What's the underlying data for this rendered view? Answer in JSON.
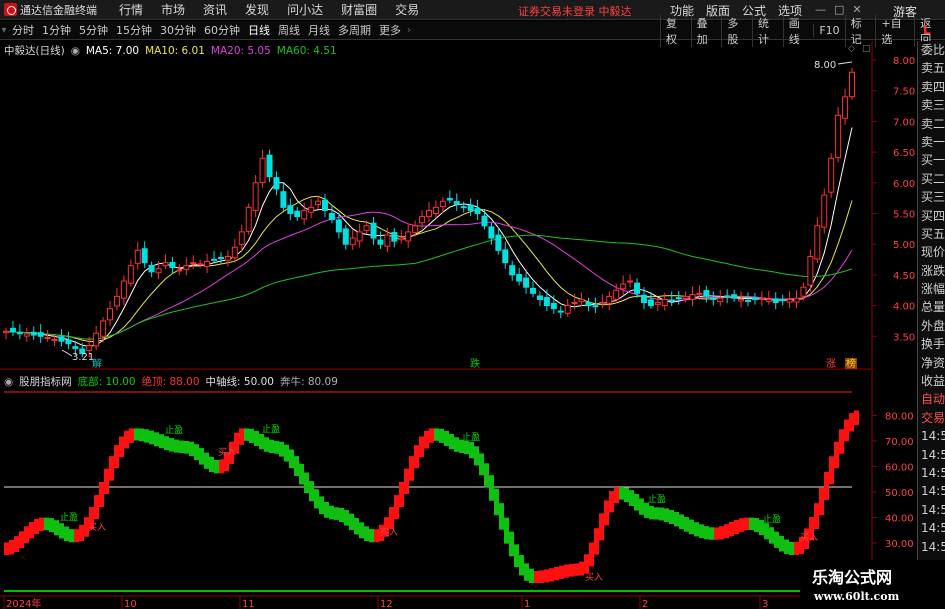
{
  "app": {
    "title": "通达信金融终端"
  },
  "menu": {
    "items": [
      "行情",
      "市场",
      "资讯",
      "发现",
      "问小达",
      "财富圈",
      "交易"
    ]
  },
  "login_msg": "证券交易未登录  中毅达",
  "menu_right": [
    "功能",
    "版面",
    "公式",
    "选项"
  ],
  "guest": "游客",
  "toolbar": {
    "periods": [
      "分时",
      "1分钟",
      "5分钟",
      "15分钟",
      "30分钟",
      "60分钟",
      "日线",
      "周线",
      "月线",
      "多周期",
      "更多"
    ],
    "active": "日线",
    "right": [
      "复权",
      "叠加",
      "多股",
      "统计",
      "画线",
      "F10",
      "标记",
      "+自选",
      "返回"
    ],
    "L": "L"
  },
  "legend": {
    "stock": "中毅达(日线)",
    "ma5": "MA5: 7.00",
    "ma10": "MA10: 6.01",
    "ma20": "MA20: 5.05",
    "ma60": "MA60: 4.51"
  },
  "colors": {
    "ma5": "#ffffff",
    "ma10": "#e8e840",
    "ma20": "#e040e0",
    "ma60": "#20c020",
    "up": "#ff3030",
    "down": "#00e0e0",
    "green": "#00c800"
  },
  "price_axis": {
    "labels": [
      "8.00",
      "7.50",
      "7.00",
      "6.50",
      "6.00",
      "5.50",
      "5.00",
      "4.50",
      "4.00",
      "3.50"
    ]
  },
  "annotations": {
    "high": "8.00",
    "low": "3.21",
    "jie": "解",
    "die": "跌",
    "zhang": "涨",
    "bang": "榜"
  },
  "indicator": {
    "name": "股朋指标网",
    "bottom": "底部: 10.00",
    "top": "绝顶: 88.00",
    "mid": "中轴线: 50.00",
    "bull": "奔牛: 80.09",
    "axis": [
      "80.00",
      "70.00",
      "60.00",
      "50.00",
      "40.00",
      "30.00"
    ],
    "markers": [
      "止盈",
      "买入"
    ]
  },
  "sidepanel": {
    "items": [
      "委比",
      "卖五",
      "卖四",
      "卖三",
      "卖二",
      "卖一",
      "买一",
      "买二",
      "买三",
      "买四",
      "买五",
      "现价",
      "涨跌",
      "涨幅",
      "总量",
      "外盘",
      "换手",
      "净资",
      "收益",
      "自动",
      "交易",
      "14:56",
      "14:56",
      "14:56",
      "14:56",
      "14:56",
      "14:56",
      "14:56"
    ]
  },
  "dates": [
    "2024年",
    "10",
    "11",
    "12",
    "1",
    "2",
    "3"
  ],
  "watermark": {
    "t1": "乐淘公式网",
    "t2": "www.60lt.com"
  }
}
